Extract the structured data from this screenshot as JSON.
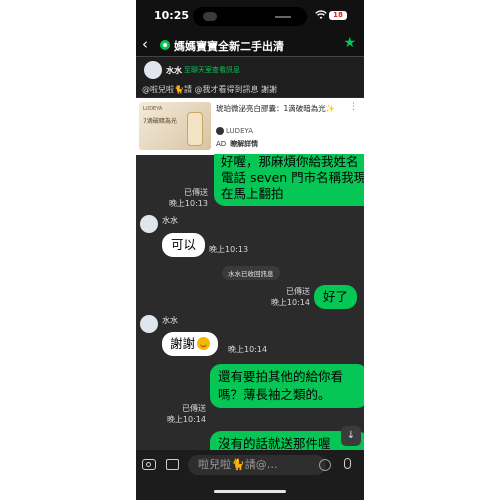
{
  "status": {
    "time": "10:25",
    "battery": "18"
  },
  "header": {
    "title": "媽媽寶寶全新二手出清",
    "back_icon": "chevron-left-icon",
    "star_icon": "star-icon"
  },
  "notices": {
    "sender": "水水",
    "link": "至聊天室查看訊息",
    "mention": "@啦兒啦🐈請 @我才看得到訊息 謝謝"
  },
  "ad": {
    "brand_small": "LUDEYA",
    "image_line": "7滴破暗為光",
    "title": "琥珀微泌亮白膠囊：1滴破暗為光✨",
    "brand": "LUDEYA",
    "label": "AD",
    "cta": "瞭解詳情"
  },
  "messages": [
    {
      "side": "out",
      "text": "好喔，那麻煩你給我姓名電話 seven 門市名稱我現在馬上翻拍",
      "status": "已傳送",
      "time": "晚上10:13"
    },
    {
      "side": "in",
      "sender": "水水",
      "text": "可以",
      "time": "晚上10:13"
    },
    {
      "side": "system",
      "text": "水水已收回訊息"
    },
    {
      "side": "out",
      "text": "好了",
      "status": "已傳送",
      "time": "晚上10:14"
    },
    {
      "side": "in",
      "sender": "水水",
      "text": "謝謝",
      "time": "晚上10:14"
    },
    {
      "side": "out",
      "text": "還有要拍其他的給你看嗎？薄長袖之類的。",
      "status": "已傳送",
      "time": "晚上10:14"
    },
    {
      "side": "out",
      "text": "沒有的話就送那件喔"
    }
  ],
  "input": {
    "placeholder": "啦兒啦🐈請@…"
  },
  "colors": {
    "accent": "#06c755",
    "background": "#2b2b2b"
  }
}
